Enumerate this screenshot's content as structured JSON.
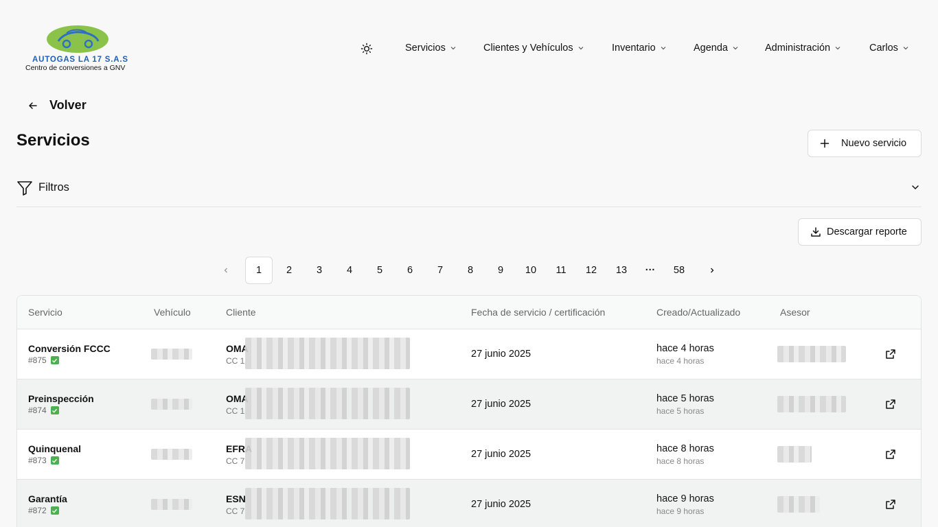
{
  "brand": {
    "name": "AUTOGAS LA 17 S.A.S",
    "tagline": "Centro de conversiones a GNV",
    "logo_color": "#8bc34a",
    "accent": "#1f5fb7"
  },
  "nav": {
    "theme_icon": "sun-icon",
    "items": [
      {
        "label": "Servicios"
      },
      {
        "label": "Clientes y Vehículos"
      },
      {
        "label": "Inventario"
      },
      {
        "label": "Agenda"
      },
      {
        "label": "Administración"
      },
      {
        "label": "Carlos"
      }
    ]
  },
  "back": {
    "label": "Volver",
    "icon": "arrow-left-icon"
  },
  "page": {
    "title": "Servicios"
  },
  "actions": {
    "new_service": "Nuevo servicio",
    "download_report": "Descargar reporte"
  },
  "filters": {
    "label": "Filtros",
    "icon": "filter-icon"
  },
  "pagination": {
    "current": "1",
    "pages": [
      "1",
      "2",
      "3",
      "4",
      "5",
      "6",
      "7",
      "8",
      "9",
      "10",
      "11",
      "12",
      "13",
      "···",
      "58"
    ]
  },
  "table": {
    "headers": {
      "servicio": "Servicio",
      "vehiculo": "Vehículo",
      "cliente": "Cliente",
      "fecha": "Fecha de servicio / certificación",
      "creado": "Creado/Actualizado",
      "asesor": "Asesor"
    },
    "rows": [
      {
        "servicio": "Conversión FCCC",
        "id": "#875",
        "cliente": "OMA",
        "doc": "CC 1.",
        "fecha": "27 junio 2025",
        "creado": "hace 4 horas",
        "actualizado": "hace 4 horas"
      },
      {
        "servicio": "Preinspección",
        "id": "#874",
        "cliente": "OMA",
        "doc": "CC 1.",
        "fecha": "27 junio 2025",
        "creado": "hace 5 horas",
        "actualizado": "hace 5 horas"
      },
      {
        "servicio": "Quinquenal",
        "id": "#873",
        "cliente": "EFRA",
        "doc": "CC 7",
        "fecha": "27 junio 2025",
        "creado": "hace 8 horas",
        "actualizado": "hace 8 horas"
      },
      {
        "servicio": "Garantía",
        "id": "#872",
        "cliente": "ESN",
        "doc": "CC 7",
        "fecha": "27 junio 2025",
        "creado": "hace 9 horas",
        "actualizado": "hace 9 horas"
      }
    ]
  }
}
